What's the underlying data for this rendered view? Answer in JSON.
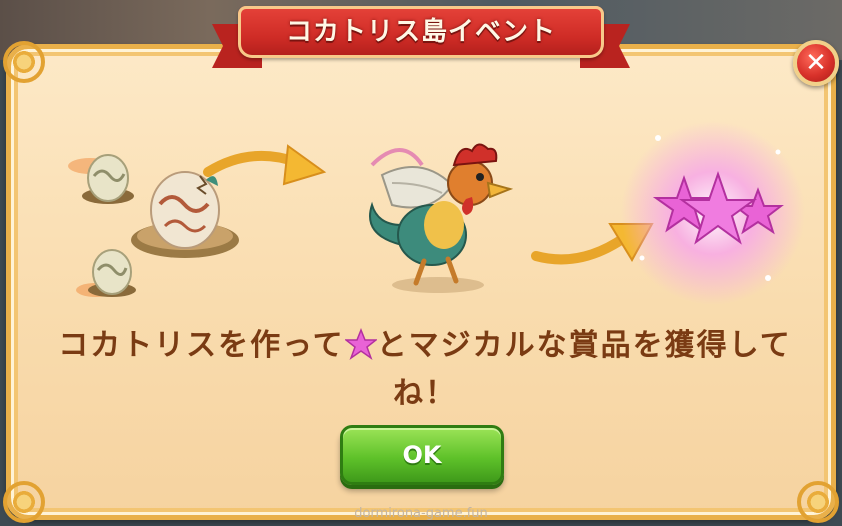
{
  "dialog": {
    "title": "コカトリス島イベント",
    "close_label": "✕",
    "message_before_star": "コカトリスを作って",
    "message_after_star": "とマジカルな賞品を獲得してね！",
    "ok_label": "OK"
  },
  "illustration": {
    "steps": [
      "eggs-icon",
      "arrow-icon",
      "cockatrice-icon",
      "arrow-icon",
      "magic-stars-icon"
    ]
  },
  "footer": {
    "watermark": "dormirona-game.fun"
  },
  "colors": {
    "ribbon": "#cf2c26",
    "panel": "#fde9c7",
    "text": "#7a3b13",
    "ok_button": "#5fc22a",
    "star": "#e963d6"
  }
}
